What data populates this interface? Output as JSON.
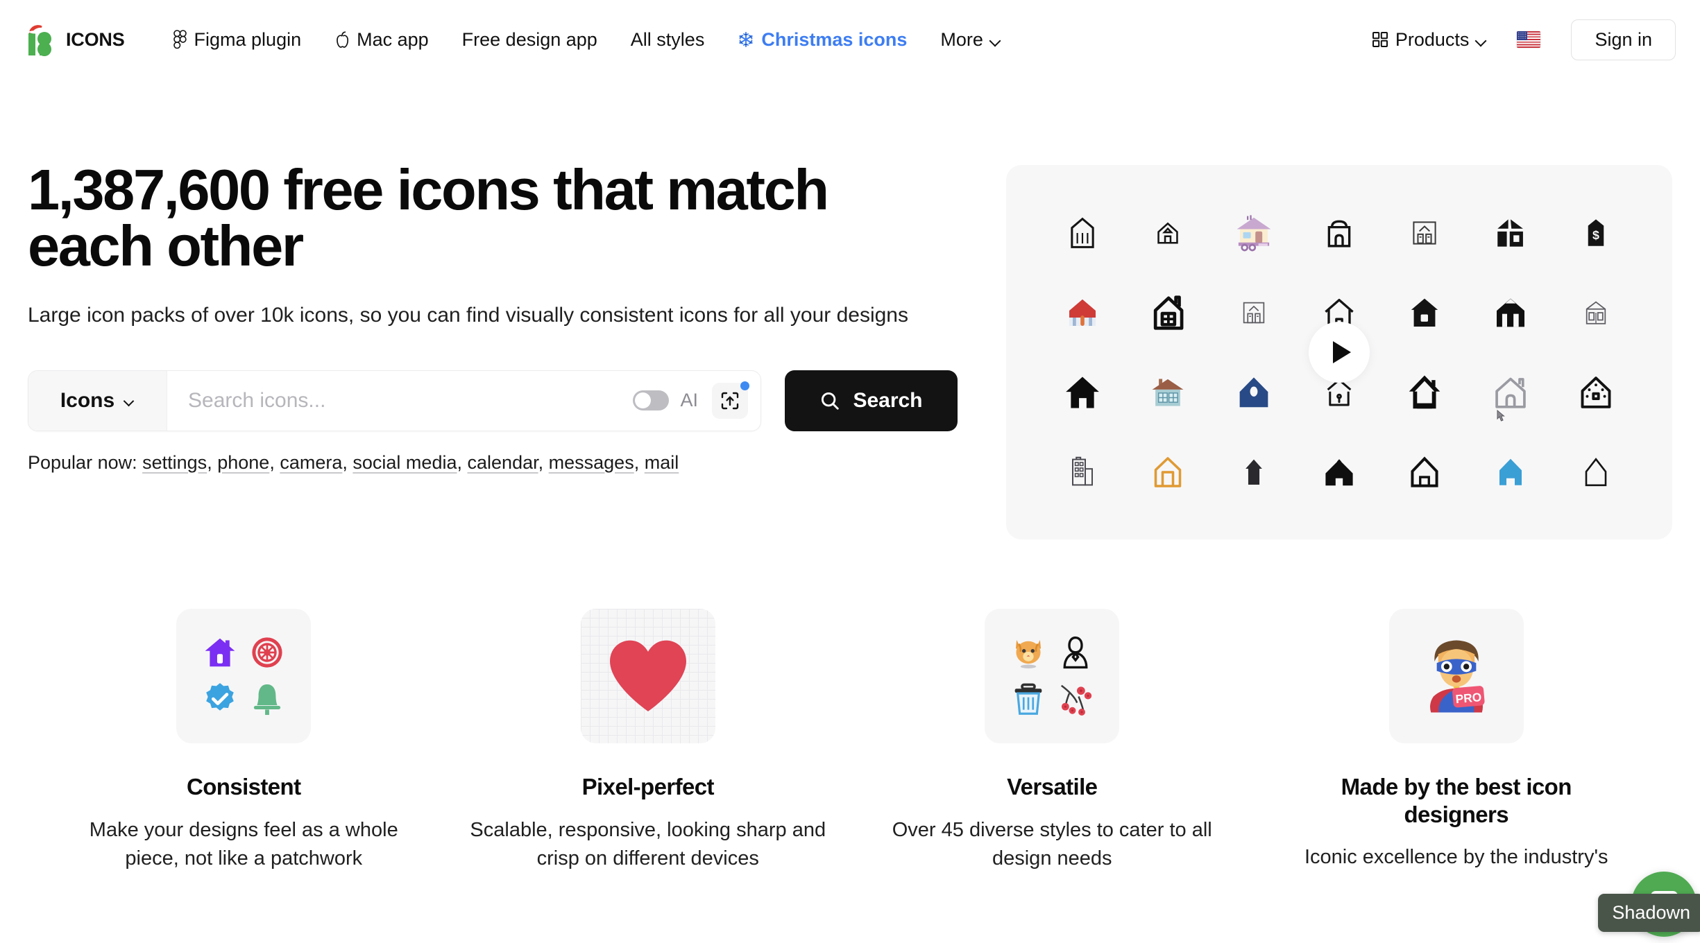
{
  "header": {
    "logo": {
      "text": "ICONS",
      "icon": "icons8-santa-logo",
      "mark_color": "#4caf50",
      "hat_color": "#e03c31"
    },
    "nav": [
      {
        "label": "Figma plugin",
        "icon": "figma-icon"
      },
      {
        "label": "Mac app",
        "icon": "apple-icon"
      },
      {
        "label": "Free design app",
        "icon": ""
      },
      {
        "label": "All styles",
        "icon": ""
      },
      {
        "label": "Christmas icons",
        "icon": "snowflake-icon",
        "accent": true,
        "color": "#3d7df2"
      },
      {
        "label": "More",
        "icon": "chevron-down-icon"
      }
    ],
    "products": {
      "label": "Products",
      "icon": "grid-squares-icon"
    },
    "language": {
      "icon": "us-flag-icon",
      "alt": "United States"
    },
    "signin": {
      "label": "Sign in"
    }
  },
  "hero": {
    "headline": "1,387,600 free icons that match each other",
    "subhead": "Large icon packs of over 10k icons, so you can find visually consistent icons for all your designs",
    "search": {
      "type_label": "Icons",
      "placeholder": "Search icons...",
      "value": "",
      "ai_label": "AI",
      "ai_enabled": false,
      "upload_icon": "upload-image-icon",
      "upload_badge": true,
      "button_label": "Search",
      "button_icon": "search-icon",
      "button_color": "#131313"
    },
    "popular": {
      "prefix": "Popular now:",
      "links": [
        "settings",
        "phone",
        "camera",
        "social media",
        "calendar",
        "messages",
        "mail"
      ]
    }
  },
  "preview": {
    "play_button": "play-icon",
    "icons": [
      {
        "name": "house-outline-tall-icon",
        "style": "line"
      },
      {
        "name": "house-small-outline-icon",
        "style": "line"
      },
      {
        "name": "trailer-house-color-icon",
        "style": "color"
      },
      {
        "name": "house-rounded-roof-icon",
        "style": "line"
      },
      {
        "name": "house-windows-outline-icon",
        "style": "line"
      },
      {
        "name": "house-filled-blocks-icon",
        "style": "filled"
      },
      {
        "name": "house-dollar-filled-icon",
        "style": "filled"
      },
      {
        "name": "house-red-roof-color-icon",
        "style": "color"
      },
      {
        "name": "house-bold-window-grid-icon",
        "style": "bold"
      },
      {
        "name": "house-thin-facade-icon",
        "style": "line"
      },
      {
        "name": "home-line-icon",
        "style": "line"
      },
      {
        "name": "house-filled-window-icon",
        "style": "filled"
      },
      {
        "name": "house-filled-arch-icon",
        "style": "filled"
      },
      {
        "name": "house-detailed-outline-icon",
        "style": "line"
      },
      {
        "name": "home-solid-icon",
        "style": "filled"
      },
      {
        "name": "cottage-color-icon",
        "style": "color"
      },
      {
        "name": "house-blue-filled-icon",
        "style": "color"
      },
      {
        "name": "house-keyhole-line-icon",
        "style": "line"
      },
      {
        "name": "house-bold-outline-icon",
        "style": "bold"
      },
      {
        "name": "house-gray-outline-icon",
        "style": "line"
      },
      {
        "name": "gingerbread-house-icon",
        "style": "bold"
      },
      {
        "name": "office-building-line-icon",
        "style": "line"
      },
      {
        "name": "house-orange-outline-icon",
        "style": "color"
      },
      {
        "name": "house-small-dark-icon",
        "style": "filled"
      },
      {
        "name": "house-solid-wide-icon",
        "style": "filled"
      },
      {
        "name": "house-outline-arch-icon",
        "style": "bold"
      },
      {
        "name": "house-blue-solid-icon",
        "style": "color"
      },
      {
        "name": "house-thin-arch-icon",
        "style": "line"
      }
    ]
  },
  "features": [
    {
      "title": "Consistent",
      "text": "Make your designs feel as a whole piece, not like a patchwork",
      "art": "quad-icons-home-gear-check-bell",
      "icons": [
        "house-purple-icon",
        "gear-red-icon",
        "verified-blue-icon",
        "bell-green-icon"
      ]
    },
    {
      "title": "Pixel-perfect",
      "text": "Scalable, responsive, looking sharp and crisp on different devices",
      "art": "heart-on-grid-paper",
      "icons": [
        "heart-red-icon"
      ]
    },
    {
      "title": "Versatile",
      "text": "Over 45 diverse styles to cater to all design needs",
      "art": "quad-icons-cat-person-trash-blossom",
      "icons": [
        "cat-color-icon",
        "person-outline-icon",
        "trash-bin-color-icon",
        "cherry-blossom-icon"
      ]
    },
    {
      "title": "Made by the best icon designers",
      "text": "Iconic excellence by the industry's",
      "art": "superhero-pro-badge",
      "icons": [
        "superhero-pro-icon"
      ]
    }
  ],
  "recorder": {
    "tooltip": "Shadown",
    "button_icon": "stop-recording-icon",
    "color": "#4faa52"
  }
}
